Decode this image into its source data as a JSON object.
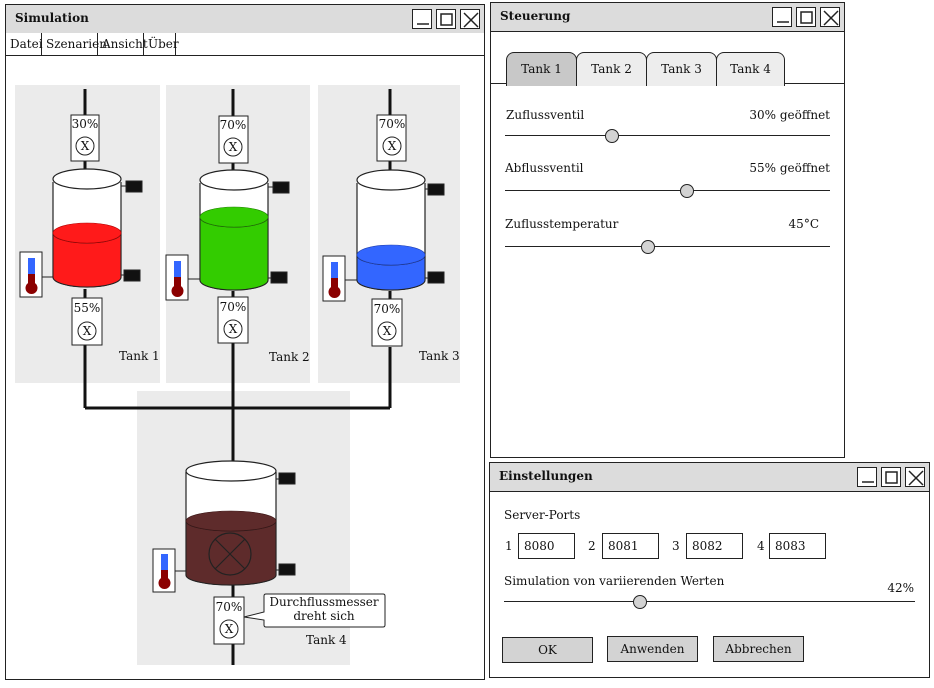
{
  "sim": {
    "title": "Simulation",
    "menu": [
      "Datei",
      "Szenarien",
      "Ansicht",
      "Über"
    ],
    "tanks": [
      {
        "name": "Tank 1",
        "inlet": "30%",
        "outlet": "55%",
        "fill": 0.45,
        "color": "#ff1a1a"
      },
      {
        "name": "Tank 2",
        "inlet": "70%",
        "outlet": "70%",
        "fill": 0.7,
        "color": "#33cc00"
      },
      {
        "name": "Tank 3",
        "inlet": "70%",
        "outlet": "70%",
        "fill": 0.3,
        "color": "#3366ff"
      },
      {
        "name": "Tank 4",
        "outlet": "70%",
        "fill": 0.55,
        "color": "#5e2b2b"
      }
    ],
    "tooltip": "Durchflussmesser dreht sich",
    "valve_symbol": "X"
  },
  "control": {
    "title": "Steuerung",
    "tabs": [
      "Tank 1",
      "Tank 2",
      "Tank 3",
      "Tank 4"
    ],
    "active_tab": 0,
    "sliders": [
      {
        "label": "Zuflussventil",
        "value": "30% geöffnet",
        "pos": 0.33
      },
      {
        "label": "Abflussventil",
        "value": "55% geöffnet",
        "pos": 0.56
      },
      {
        "label": "Zuflusstemperatur",
        "value": "45°C",
        "pos": 0.44
      }
    ]
  },
  "settings": {
    "title": "Einstellungen",
    "ports_label": "Server-Ports",
    "ports": [
      {
        "num": "1",
        "value": "8080"
      },
      {
        "num": "2",
        "value": "8081"
      },
      {
        "num": "3",
        "value": "8082"
      },
      {
        "num": "4",
        "value": "8083"
      }
    ],
    "variation_label": "Simulation von variierenden Werten",
    "variation_value": "42%",
    "variation_pos": 0.33,
    "buttons": {
      "ok": "OK",
      "apply": "Anwenden",
      "cancel": "Abbrechen"
    }
  },
  "icons": {
    "minimize": "minimize-icon",
    "maximize": "maximize-icon",
    "close": "close-icon",
    "thermometer": "thermometer-icon",
    "valve": "valve-icon",
    "sensor": "sensor-icon"
  }
}
